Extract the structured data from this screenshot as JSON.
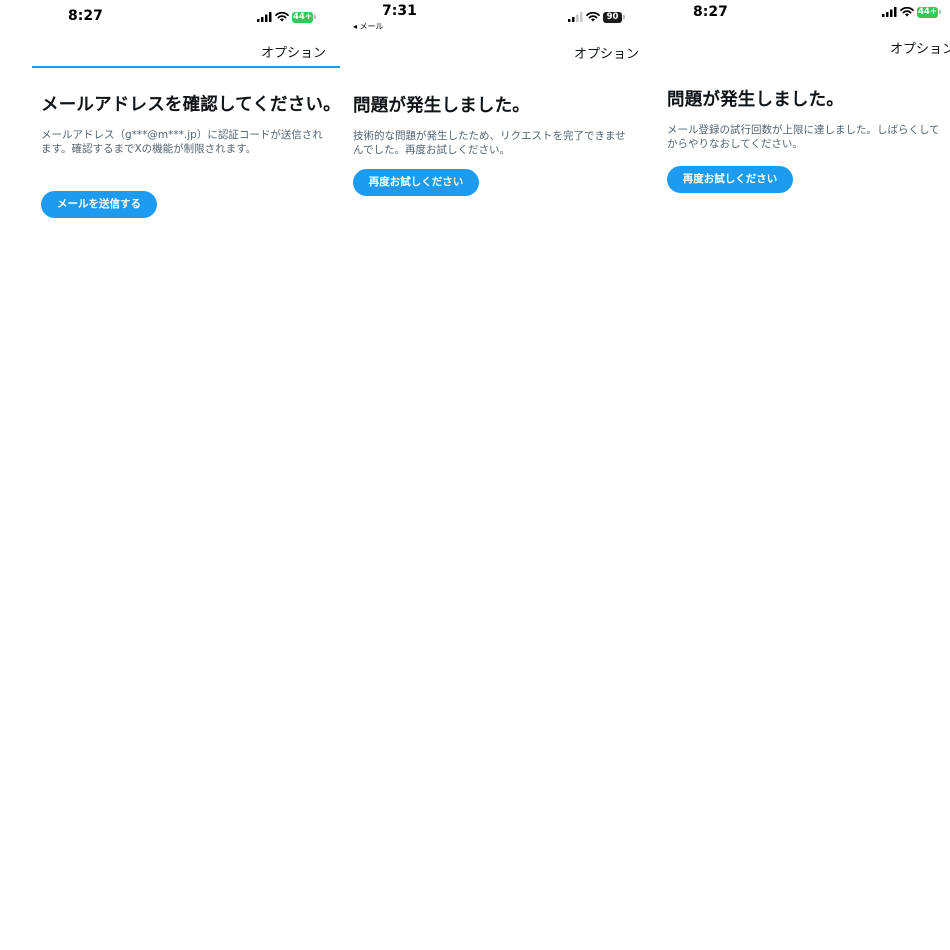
{
  "screens": [
    {
      "status": {
        "time": "8:27",
        "battery": "44+",
        "battery_color": "#34c759"
      },
      "header": {
        "options_label": "オプション"
      },
      "title": "メールアドレスを確認してください。",
      "body_lines": [
        "メールアドレス（g***@m***.jp）に認証コードが送信され",
        "ます。確認するまでXの機能が制限されます。"
      ],
      "button_label": "メールを送信する"
    },
    {
      "status": {
        "time": "7:31",
        "back_label": "◂ メール",
        "battery": "90",
        "battery_color": "#1c1c1e"
      },
      "header": {
        "options_label": "オプション"
      },
      "title": "問題が発生しました。",
      "body_lines": [
        "技術的な問題が発生したため、リクエストを完了できませ",
        "んでした。再度お試しください。"
      ],
      "button_label": "再度お試しください"
    },
    {
      "status": {
        "time": "8:27",
        "battery": "44+",
        "battery_color": "#34c759"
      },
      "header": {
        "options_label": "オプション"
      },
      "title": "問題が発生しました。",
      "body_lines": [
        "メール登録の試行回数が上限に達しました。しばらくして",
        "からやりなおしてください。"
      ],
      "button_label": "再度お試しください"
    }
  ],
  "icons": [
    "signal-icon",
    "wifi-icon",
    "battery-icon"
  ],
  "colors": {
    "accent": "#1d9bf0",
    "text": "#0f1419",
    "secondary_text": "#536471"
  }
}
